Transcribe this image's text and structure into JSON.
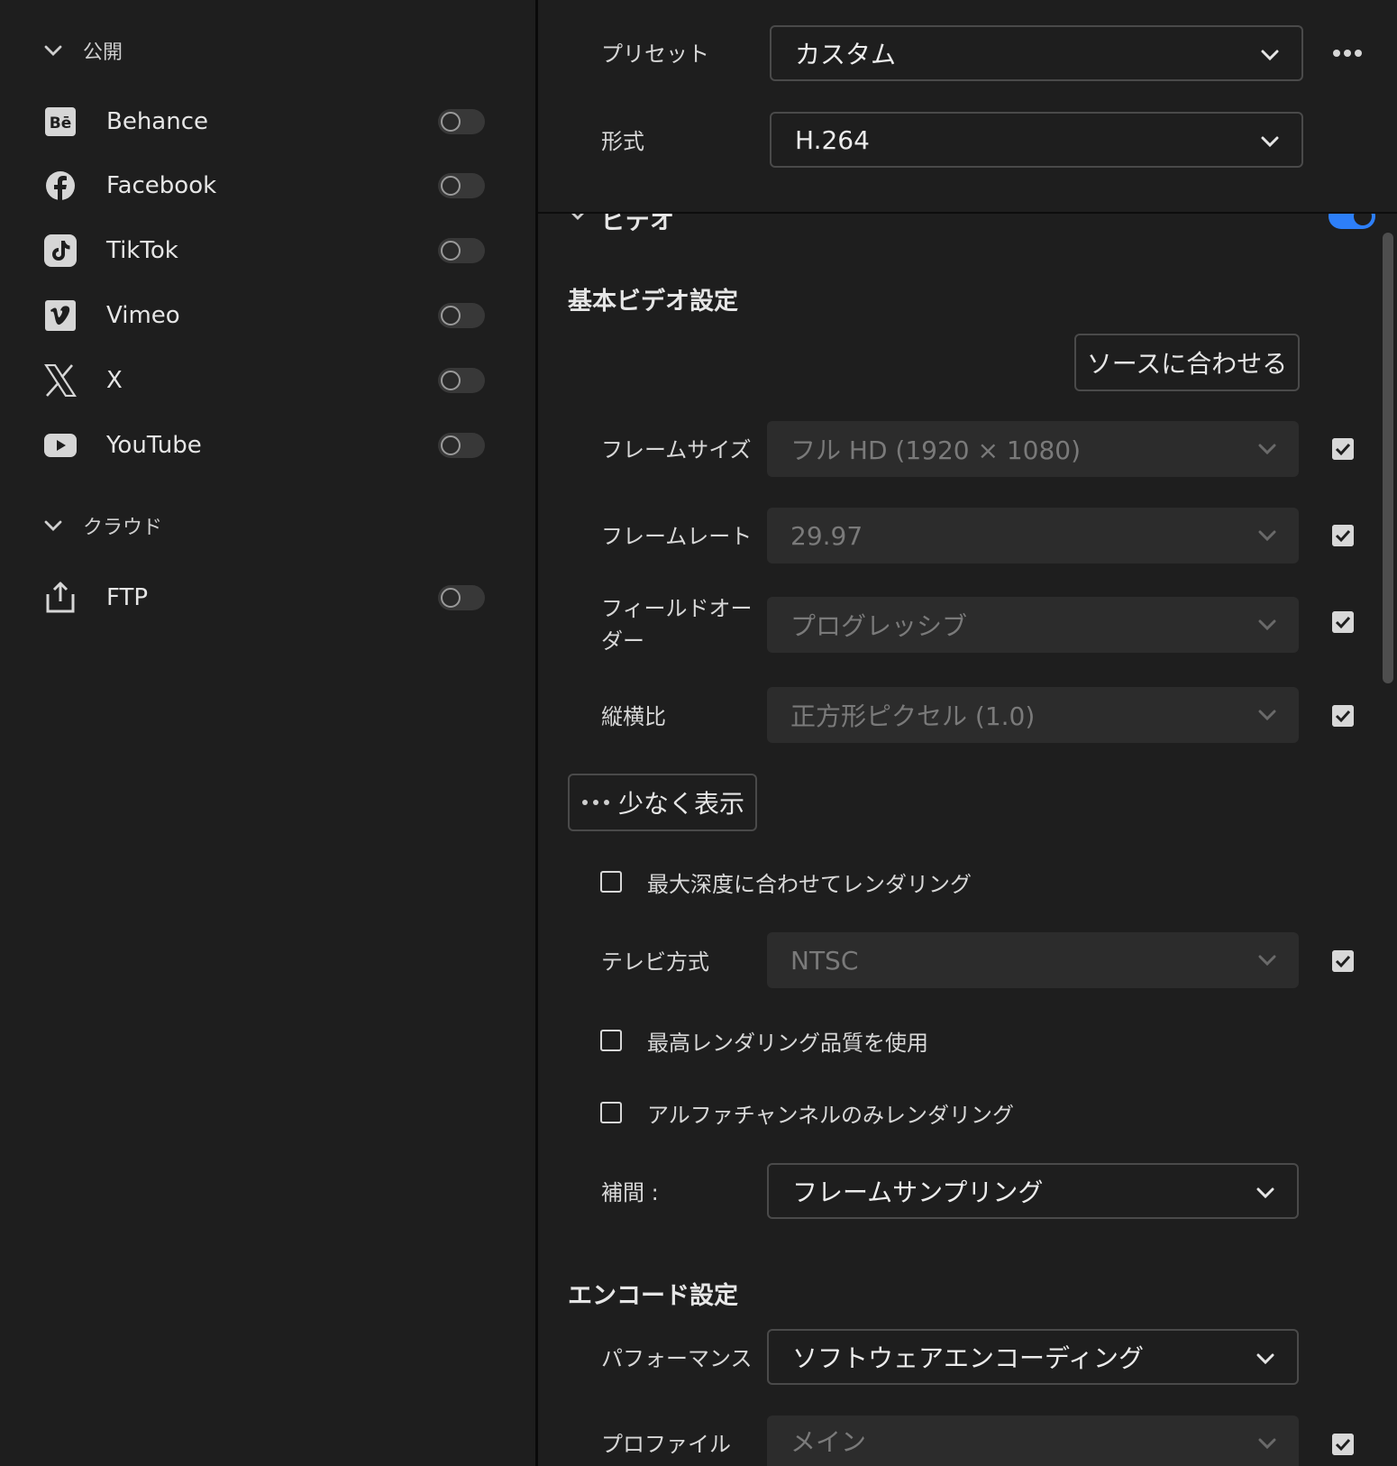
{
  "publish": {
    "section_label": "公開",
    "destinations": [
      {
        "name": "Behance",
        "icon": "behance-icon",
        "enabled": false
      },
      {
        "name": "Facebook",
        "icon": "facebook-icon",
        "enabled": false
      },
      {
        "name": "TikTok",
        "icon": "tiktok-icon",
        "enabled": false
      },
      {
        "name": "Vimeo",
        "icon": "vimeo-icon",
        "enabled": false
      },
      {
        "name": "X",
        "icon": "x-icon",
        "enabled": false
      },
      {
        "name": "YouTube",
        "icon": "youtube-icon",
        "enabled": false
      }
    ]
  },
  "cloud": {
    "section_label": "クラウド",
    "destinations": [
      {
        "name": "FTP",
        "icon": "upload-icon",
        "enabled": false
      }
    ]
  },
  "settings": {
    "preset_label": "プリセット",
    "preset_value": "カスタム",
    "format_label": "形式",
    "format_value": "H.264",
    "more_icon": "more-icon",
    "video_section_label": "ビデオ",
    "video_enabled": true,
    "basic_heading": "基本ビデオ設定",
    "match_source_label": "ソースに合わせる",
    "frame_size_label": "フレームサイズ",
    "frame_size_value": "フル HD (1920 × 1080)",
    "frame_size_checked": true,
    "frame_rate_label": "フレームレート",
    "frame_rate_value": "29.97",
    "frame_rate_checked": true,
    "field_order_label_line1": "フィールドオー",
    "field_order_label_line2": "ダー",
    "field_order_value": "プログレッシブ",
    "field_order_checked": true,
    "aspect_label": "縦横比",
    "aspect_value": "正方形ピクセル (1.0)",
    "aspect_checked": true,
    "show_less_label": "少なく表示",
    "max_depth_label": "最大深度に合わせてレンダリング",
    "max_depth_checked": false,
    "tv_standard_label": "テレビ方式",
    "tv_standard_value": "NTSC",
    "tv_standard_checked": true,
    "max_quality_label": "最高レンダリング品質を使用",
    "max_quality_checked": false,
    "alpha_only_label": "アルファチャンネルのみレンダリング",
    "alpha_only_checked": false,
    "interpolation_label": "補間 :",
    "interpolation_value": "フレームサンプリング",
    "encode_heading": "エンコード設定",
    "performance_label": "パフォーマンス",
    "performance_value": "ソフトウェアエンコーディング",
    "profile_label": "プロファイル",
    "profile_value": "メイン",
    "profile_checked": true
  }
}
